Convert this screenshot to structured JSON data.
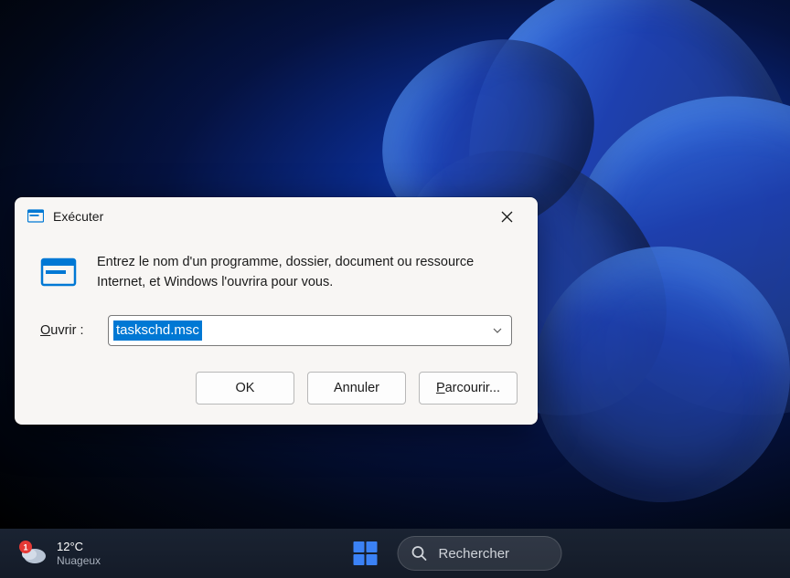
{
  "dialog": {
    "title": "Exécuter",
    "description": "Entrez le nom d'un programme, dossier, document ou ressource Internet, et Windows l'ouvrira pour vous.",
    "open_label_prefix": "O",
    "open_label_rest": "uvrir :",
    "input_value": "taskschd.msc",
    "buttons": {
      "ok": "OK",
      "cancel": "Annuler",
      "browse_prefix": "P",
      "browse_rest": "arcourir..."
    }
  },
  "taskbar": {
    "weather": {
      "badge": "1",
      "temperature": "12°C",
      "condition": "Nuageux"
    },
    "search_placeholder": "Rechercher"
  }
}
